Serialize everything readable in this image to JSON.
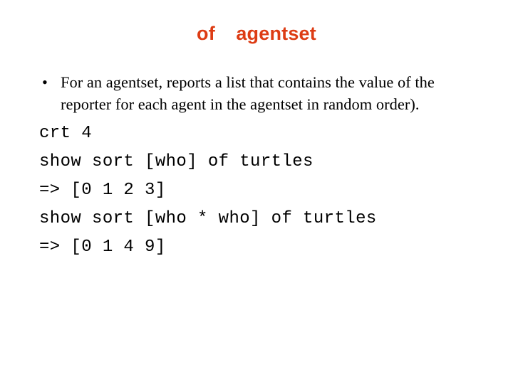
{
  "slide": {
    "title": "of  agentset",
    "title_color": "#dd3c14",
    "background_color": "#ffffff",
    "text_color": "#000000"
  },
  "body": {
    "bullets": [
      {
        "marker": "•",
        "text": "For an agentset, reports a list that contains the value of the reporter for each agent in the agentset in random order)."
      }
    ],
    "code_lines": [
      "crt 4",
      "show sort [who] of turtles",
      "=> [0 1 2 3]",
      "show sort [who * who] of turtles",
      "=> [0 1 4 9]"
    ]
  }
}
